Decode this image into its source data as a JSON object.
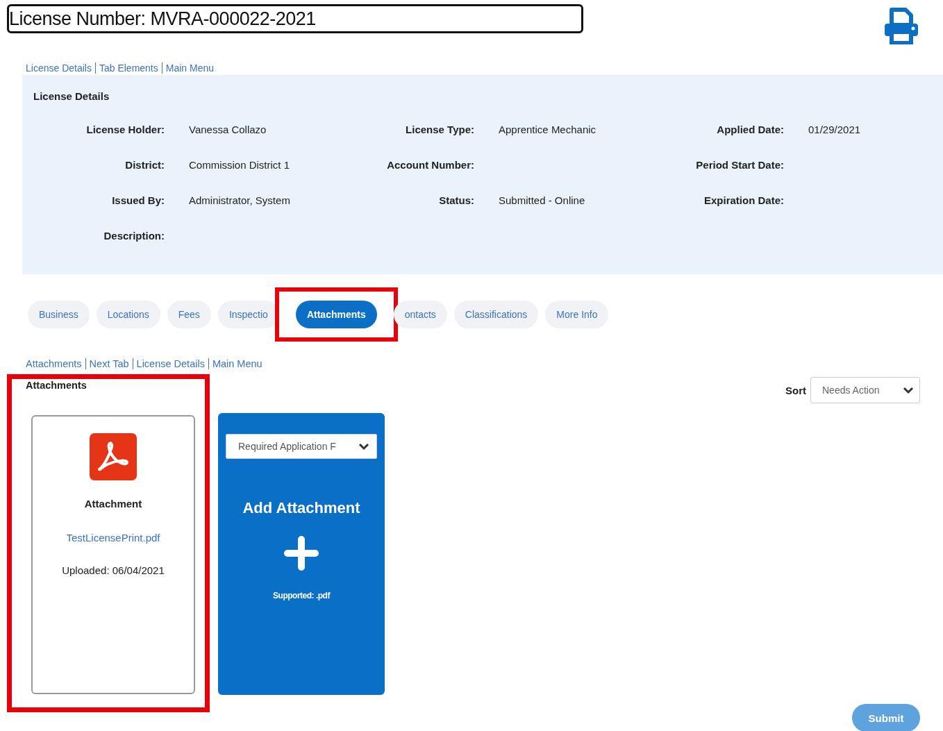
{
  "header": {
    "title": "License Number: MVRA-000022-2021"
  },
  "top_links": [
    "License Details",
    "Tab Elements",
    "Main Menu"
  ],
  "details": {
    "heading": "License Details",
    "fields": [
      {
        "label": "License Holder:",
        "value": "Vanessa Collazo"
      },
      {
        "label": "License Type:",
        "value": "Apprentice Mechanic"
      },
      {
        "label": "Applied Date:",
        "value": "01/29/2021"
      },
      {
        "label": "District:",
        "value": "Commission District 1"
      },
      {
        "label": "Account Number:"
      },
      {
        "label": "Period Start Date:"
      },
      {
        "label": "Issued By:",
        "value": "Administrator, System"
      },
      {
        "label": "Status:",
        "value": "Submitted - Online"
      },
      {
        "label": "Expiration Date:"
      },
      {
        "label": "Description:"
      }
    ]
  },
  "tabs": [
    {
      "label": "Business",
      "selected": false,
      "highlighted": false
    },
    {
      "label": "Locations",
      "selected": false,
      "highlighted": false
    },
    {
      "label": "Fees",
      "selected": false,
      "highlighted": false
    },
    {
      "label": "Inspectio",
      "selected": false,
      "highlighted": false
    },
    {
      "label": "Attachments",
      "selected": true,
      "highlighted": true
    },
    {
      "label": "ontacts",
      "selected": false,
      "highlighted": false
    },
    {
      "label": "Classifications",
      "selected": false,
      "highlighted": false
    },
    {
      "label": "More Info",
      "selected": false,
      "highlighted": false
    }
  ],
  "section_links": [
    "Attachments",
    "Next Tab",
    "License Details",
    "Main Menu"
  ],
  "attachments": {
    "heading": "Attachments",
    "highlighted": true,
    "sort": {
      "label": "Sort",
      "value": "Needs Action"
    },
    "cards": [
      {
        "kind": "file",
        "title": "Attachment",
        "file": "TestLicensePrint.pdf",
        "uploaded": "Uploaded: 06/04/2021"
      },
      {
        "kind": "add",
        "type_select": "Required Application F",
        "title": "Add Attachment",
        "note": "Supported: .pdf"
      }
    ]
  },
  "submit": {
    "label": "Submit",
    "disabled": true
  }
}
